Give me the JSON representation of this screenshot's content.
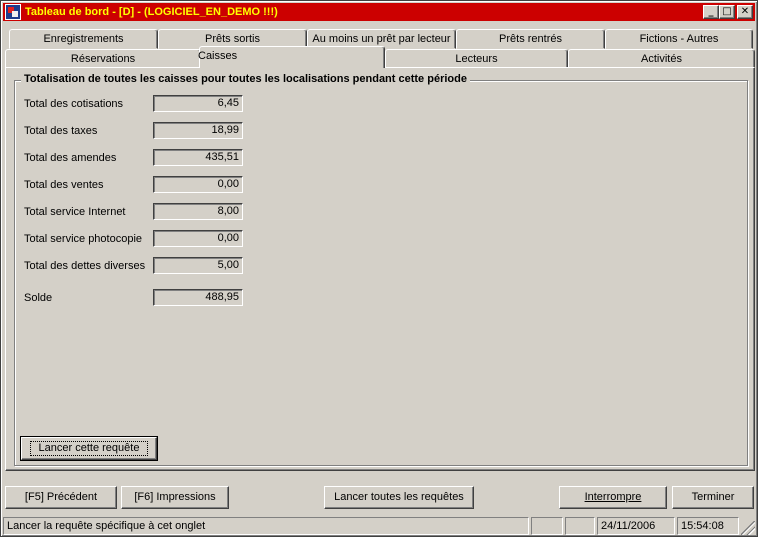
{
  "window": {
    "title": "Tableau de bord - [D] - (LOGICIEL_EN_DEMO !!!)",
    "minimize": "_",
    "maximize": "□",
    "close": "✕"
  },
  "tabs": {
    "row1": [
      "Enregistrements",
      "Prêts sortis",
      "Au moins un prêt par lecteur",
      "Prêts rentrés",
      "Fictions - Autres"
    ],
    "row2": [
      "Réservations",
      "Caisses",
      "Lecteurs",
      "Activités"
    ],
    "active": "Caisses"
  },
  "group": {
    "title": "Totalisation de toutes les caisses pour toutes les localisations pendant cette période",
    "rows": [
      {
        "label": "Total des cotisations",
        "value": "6,45"
      },
      {
        "label": "Total des taxes",
        "value": "18,99"
      },
      {
        "label": "Total des amendes",
        "value": "435,51"
      },
      {
        "label": "Total des ventes",
        "value": "0,00"
      },
      {
        "label": "Total service Internet",
        "value": "8,00"
      },
      {
        "label": "Total service photocopie",
        "value": "0,00"
      },
      {
        "label": "Total des dettes diverses",
        "value": "5,00"
      }
    ],
    "solde": {
      "label": "Solde",
      "value": "488,95"
    },
    "run_button": "Lancer cette requête"
  },
  "footer": {
    "precedent": "[F5] Précédent",
    "impressions": "[F6] Impressions",
    "lancer_toutes": "Lancer toutes les requêtes",
    "interrompre": "Interrompre",
    "terminer": "Terminer"
  },
  "status": {
    "message": "Lancer la requête spécifique à cet onglet",
    "date": "24/11/2006",
    "time": "15:54:08"
  }
}
